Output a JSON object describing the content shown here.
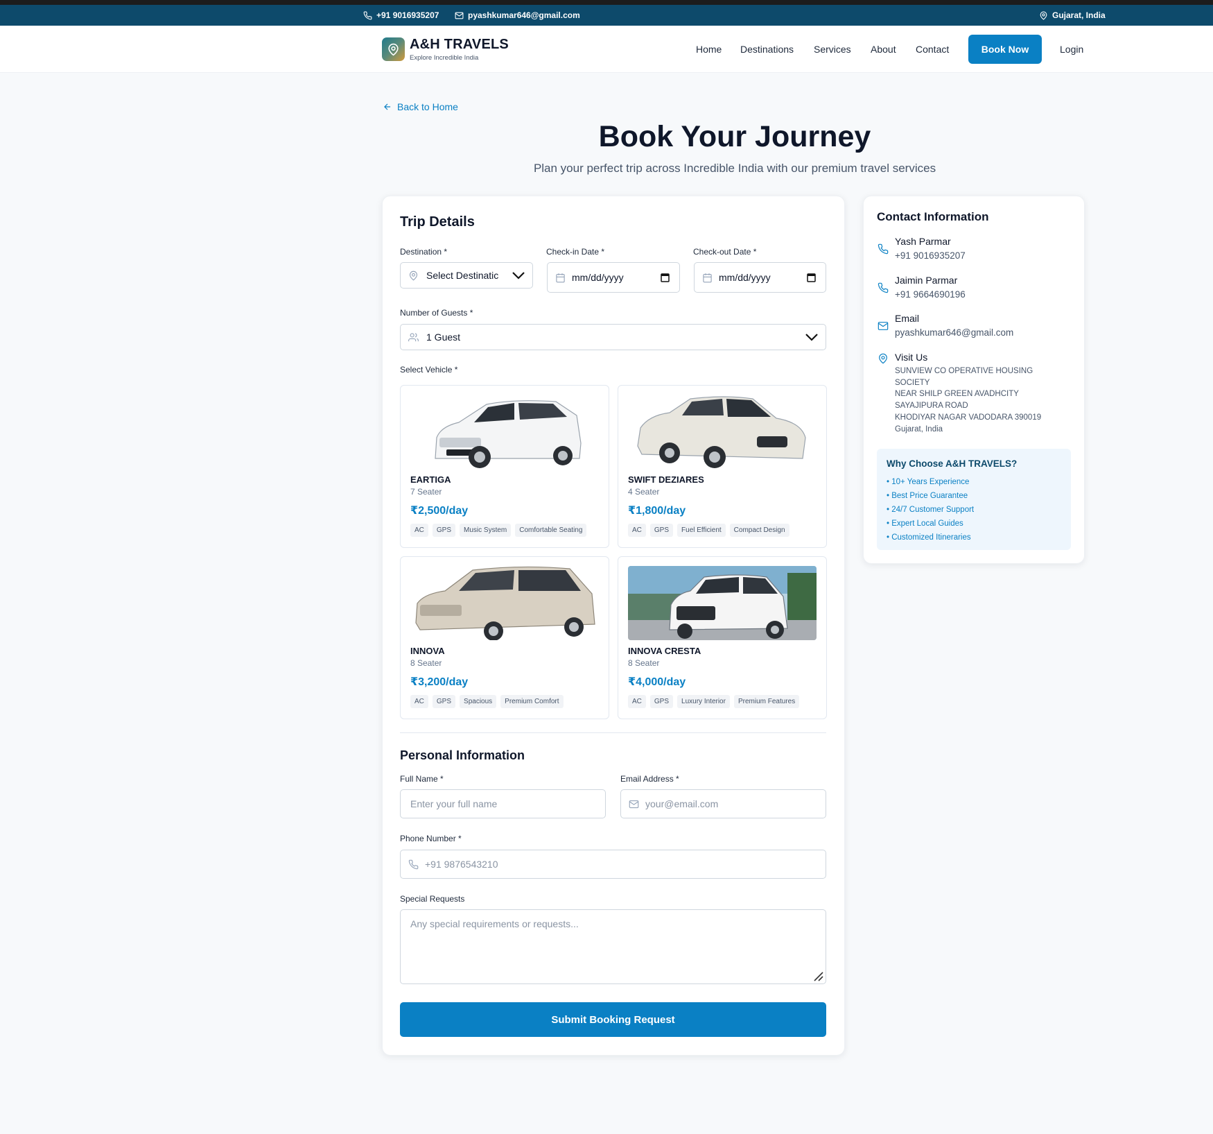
{
  "topbar": {
    "phone": "+91 9016935207",
    "email": "pyashkumar646@gmail.com",
    "location": "Gujarat, India"
  },
  "brand": {
    "name": "A&H TRAVELS",
    "tagline": "Explore Incredible India",
    "logo_icon": "map-pin-icon"
  },
  "nav": {
    "links": [
      "Home",
      "Destinations",
      "Services",
      "About",
      "Contact"
    ],
    "book_label": "Book Now",
    "login_label": "Login"
  },
  "page": {
    "back_label": "Back to Home",
    "title": "Book Your Journey",
    "subtitle": "Plan your perfect trip across Incredible India with our premium travel services"
  },
  "trip": {
    "title": "Trip Details",
    "destination_label": "Destination *",
    "destination_value": "Select Destinatic",
    "checkin_label": "Check-in Date *",
    "checkin_value": "mm/dd/yyyy",
    "checkout_label": "Check-out Date *",
    "checkout_value": "mm/dd/yyyy",
    "guests_label": "Number of Guests *",
    "guests_value": "1 Guest",
    "vehicle_label": "Select Vehicle *"
  },
  "vehicles": [
    {
      "name": "EARTIGA",
      "seats": "7 Seater",
      "price": "₹2,500/day",
      "features": [
        "AC",
        "GPS",
        "Music System",
        "Comfortable Seating"
      ]
    },
    {
      "name": "SWIFT DEZIARES",
      "seats": "4 Seater",
      "price": "₹1,800/day",
      "features": [
        "AC",
        "GPS",
        "Fuel Efficient",
        "Compact Design"
      ]
    },
    {
      "name": "INNOVA",
      "seats": "8 Seater",
      "price": "₹3,200/day",
      "features": [
        "AC",
        "GPS",
        "Spacious",
        "Premium Comfort"
      ]
    },
    {
      "name": "INNOVA CRESTA",
      "seats": "8 Seater",
      "price": "₹4,000/day",
      "features": [
        "AC",
        "GPS",
        "Luxury Interior",
        "Premium Features"
      ]
    }
  ],
  "personal": {
    "title": "Personal Information",
    "name_label": "Full Name *",
    "name_placeholder": "Enter your full name",
    "email_label": "Email Address *",
    "email_placeholder": "your@email.com",
    "phone_label": "Phone Number *",
    "phone_placeholder": "+91 9876543210",
    "requests_label": "Special Requests",
    "requests_placeholder": "Any special requirements or requests...",
    "submit_label": "Submit Booking Request"
  },
  "contact": {
    "title": "Contact Information",
    "person1_name": "Yash Parmar",
    "person1_phone": "+91 9016935207",
    "person2_name": "Jaimin Parmar",
    "person2_phone": "+91 9664690196",
    "email_title": "Email",
    "email_value": "pyashkumar646@gmail.com",
    "visit_title": "Visit Us",
    "address_lines": [
      "SUNVIEW CO OPERATIVE HOUSING",
      "SOCIETY",
      "NEAR SHILP GREEN AVADHCITY",
      "SAYAJIPURA ROAD",
      "KHODIYAR NAGAR VADODARA 390019",
      "Gujarat, India"
    ]
  },
  "why": {
    "title": "Why Choose A&H TRAVELS?",
    "items": [
      "• 10+ Years Experience",
      "• Best Price Guarantee",
      "• 24/7 Customer Support",
      "• Expert Local Guides",
      "• Customized Itineraries"
    ]
  },
  "colors": {
    "primary": "#0a80c4",
    "topbar": "#0d4a6b",
    "background": "#f7f9fb"
  }
}
